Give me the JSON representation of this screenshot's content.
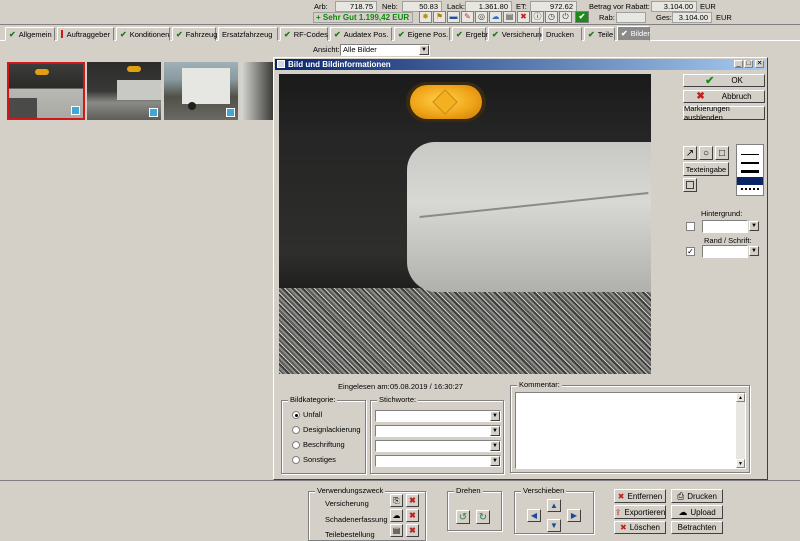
{
  "header": {
    "arb_label": "Arb:",
    "arb_value": "718.75",
    "neb_label": "Neb:",
    "neb_value": "50.83",
    "lack_label": "Lack:",
    "lack_value": "1.361.80",
    "et_label": "ET:",
    "et_value": "972.62",
    "betrag_label": "Betrag vor Rabatt:",
    "betrag_value": "3.104.00",
    "betrag_currency": "EUR",
    "rab_label": "Rab:",
    "ges_label": "Ges:",
    "ges_value": "3.104.00",
    "ges_currency": "EUR",
    "rating_text": "+ Sehr Gut 1.199,42 EUR"
  },
  "tabs": [
    {
      "label": "Allgemein",
      "mark": "check"
    },
    {
      "label": "Auftraggeber",
      "mark": "bar"
    },
    {
      "label": "Konditionen",
      "mark": "check"
    },
    {
      "label": "Fahrzeug",
      "mark": "check"
    },
    {
      "label": "Ersatzfahrzeug",
      "mark": "none"
    },
    {
      "label": "RF-Codes",
      "mark": "check"
    },
    {
      "label": "Audatex Pos.",
      "mark": "check"
    },
    {
      "label": "Eigene Pos.",
      "mark": "check"
    },
    {
      "label": "Ergebnis",
      "mark": "check"
    },
    {
      "label": "Versicherung",
      "mark": "check"
    },
    {
      "label": "Drucken",
      "mark": "none"
    },
    {
      "label": "Teile",
      "mark": "check"
    },
    {
      "label": "Bilder",
      "mark": "check"
    }
  ],
  "view": {
    "label": "Ansicht:",
    "selected": "Alle Bilder"
  },
  "dialog": {
    "title": "Bild und Bildinformationen",
    "ok": "OK",
    "abbruch": "Abbruch",
    "markierungen": "Markierungen ausblenden",
    "texteingabe": "Texteingabe",
    "hintergrund": "Hintergrund:",
    "rand_schrift": "Rand / Schrift:",
    "eingelesen_label": "Eingelesen am:",
    "eingelesen_value": "05.08.2019 / 16:30:27",
    "bildkategorie_title": "Bildkategorie:",
    "categories": [
      "Unfall",
      "Designlackierung",
      "Beschriftung",
      "Sonstiges"
    ],
    "stichworte_title": "Stichworte:",
    "kommentar_title": "Kommentar:"
  },
  "bottom": {
    "verwendung_title": "Verwendungszweck",
    "verwendung_items": [
      "Versicherung",
      "Schadenerfassung",
      "Teilebestellung"
    ],
    "drehen_title": "Drehen",
    "verschieben_title": "Verschieben",
    "entfernen": "Entfernen",
    "exportieren": "Exportieren",
    "loeschen": "Löschen",
    "drucken": "Drucken",
    "upload": "Upload",
    "betrachten": "Betrachten"
  }
}
